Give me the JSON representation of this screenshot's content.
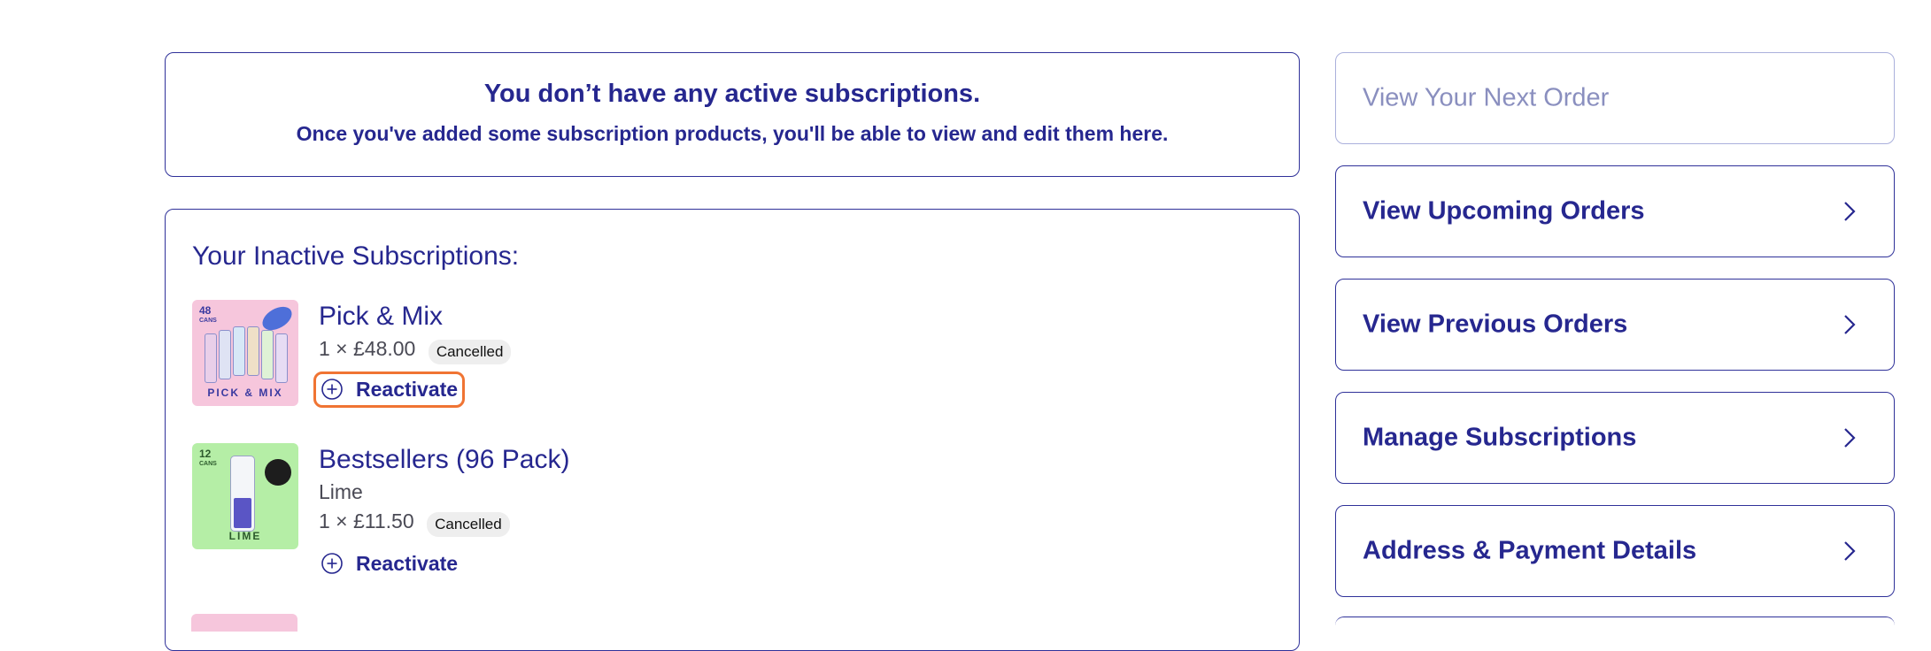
{
  "notice": {
    "title": "You don’t have any active subscriptions.",
    "text": "Once you've added some subscription products, you'll be able to view and edit them here."
  },
  "inactive": {
    "heading": "Your Inactive Subscriptions:",
    "items": [
      {
        "name": "Pick & Mix",
        "price": "1 × £48.00",
        "status": "Cancelled",
        "action": "Reactivate",
        "thumb_count": "48",
        "thumb_count_sub": "CANS",
        "thumb_label": "PICK & MIX"
      },
      {
        "name": "Bestsellers (96 Pack)",
        "variant": "Lime",
        "price": "1 × £11.50",
        "status": "Cancelled",
        "action": "Reactivate",
        "thumb_count": "12",
        "thumb_count_sub": "CANS",
        "thumb_label": "LIME"
      }
    ]
  },
  "sidebar": {
    "items": [
      {
        "label": "View Your Next Order"
      },
      {
        "label": "View Upcoming Orders"
      },
      {
        "label": "View Previous Orders"
      },
      {
        "label": "Manage Subscriptions"
      },
      {
        "label": "Address & Payment Details"
      }
    ]
  },
  "colors": {
    "primary": "#26278f",
    "highlight": "#f07433",
    "badge_bg": "#eeeeee",
    "thumb_pink": "#f6c6dc",
    "thumb_green": "#b5eea6"
  }
}
